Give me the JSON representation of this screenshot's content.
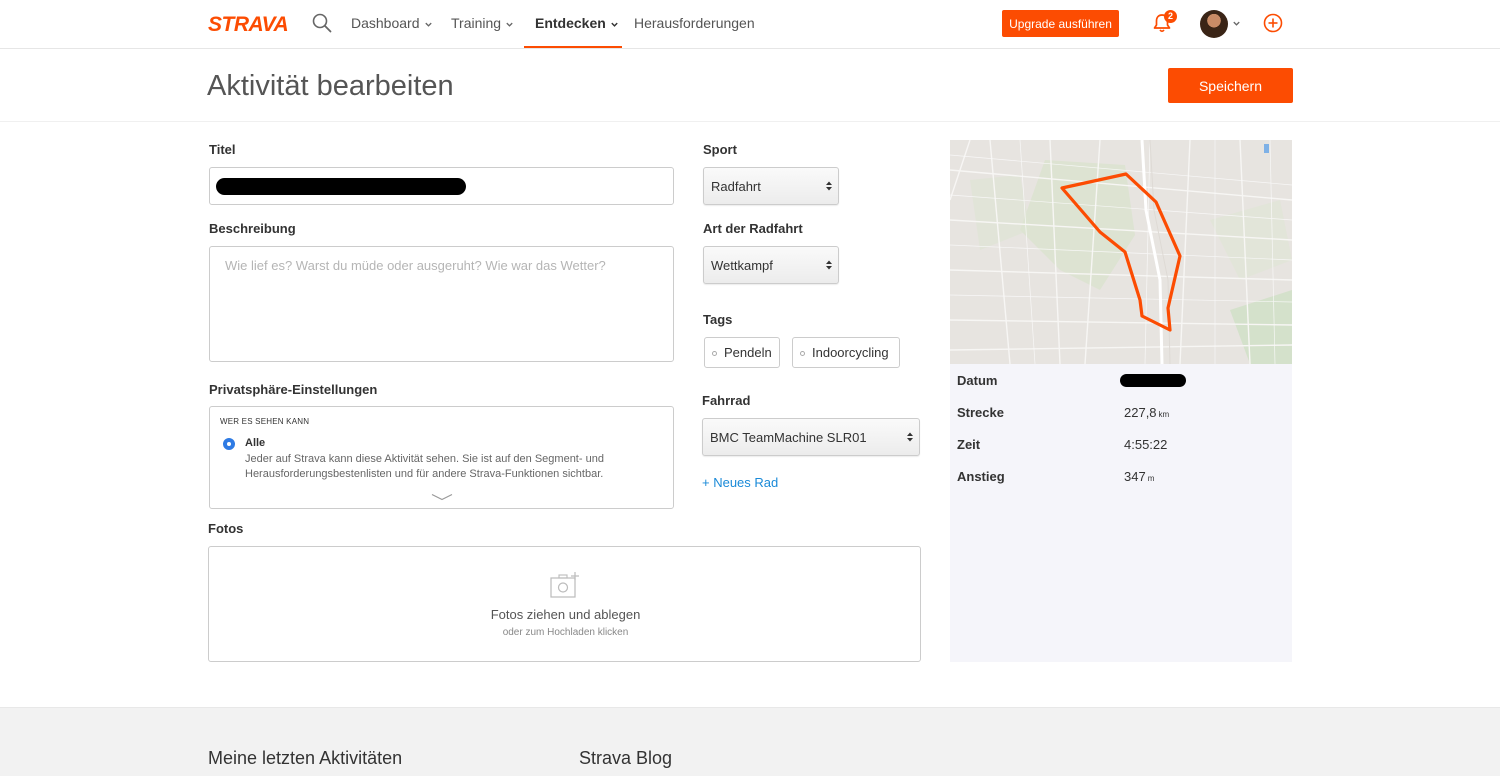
{
  "nav": {
    "logo": "STRAVA",
    "items": [
      {
        "label": "Dashboard",
        "has_dropdown": true,
        "active": false
      },
      {
        "label": "Training",
        "has_dropdown": true,
        "active": false
      },
      {
        "label": "Entdecken",
        "has_dropdown": true,
        "active": true
      },
      {
        "label": "Herausforderungen",
        "has_dropdown": false,
        "active": false
      }
    ],
    "upgrade_label": "Upgrade ausführen",
    "notification_count": "2",
    "icons": [
      "search-icon",
      "bell-icon",
      "avatar",
      "chevron-down-icon",
      "plus-circle-icon"
    ]
  },
  "header": {
    "title": "Aktivität bearbeiten",
    "save_label": "Speichern"
  },
  "form": {
    "title_label": "Titel",
    "title_value": "",
    "description_label": "Beschreibung",
    "description_placeholder": "Wie lief es? Warst du müde oder ausgeruht? Wie war das Wetter?",
    "privacy_label": "Privatsphäre-Einstellungen",
    "privacy_heading": "WER ES SEHEN KANN",
    "privacy_option": "Alle",
    "privacy_description": "Jeder auf Strava kann diese Aktivität sehen. Sie ist auf den Segment- und Herausforderungsbestenlisten und für andere Strava-Funktionen sichtbar.",
    "photos_label": "Fotos",
    "photos_main": "Fotos ziehen und ablegen",
    "photos_sub": "oder zum Hochladen klicken",
    "sport_label": "Sport",
    "sport_value": "Radfahrt",
    "ride_type_label": "Art der Radfahrt",
    "ride_type_value": "Wettkampf",
    "tags_label": "Tags",
    "tags": [
      "Pendeln",
      "Indoorcycling"
    ],
    "bike_label": "Fahrrad",
    "bike_value": "BMC TeamMachine SLR01",
    "new_bike_label": "+ Neues Rad"
  },
  "summary": {
    "date_label": "Datum",
    "date_value": "",
    "distance_label": "Strecke",
    "distance_value": "227,8",
    "distance_unit": "km",
    "time_label": "Zeit",
    "time_value": "4:55:22",
    "elevation_label": "Anstieg",
    "elevation_value": "347",
    "elevation_unit": "m",
    "route_color": "#fc4c02"
  },
  "footer": {
    "recent_heading": "Meine letzten Aktivitäten",
    "blog_heading": "Strava Blog"
  },
  "colors": {
    "brand": "#fc4c02",
    "link": "#1a8ad8",
    "radio": "#2f7be4"
  }
}
